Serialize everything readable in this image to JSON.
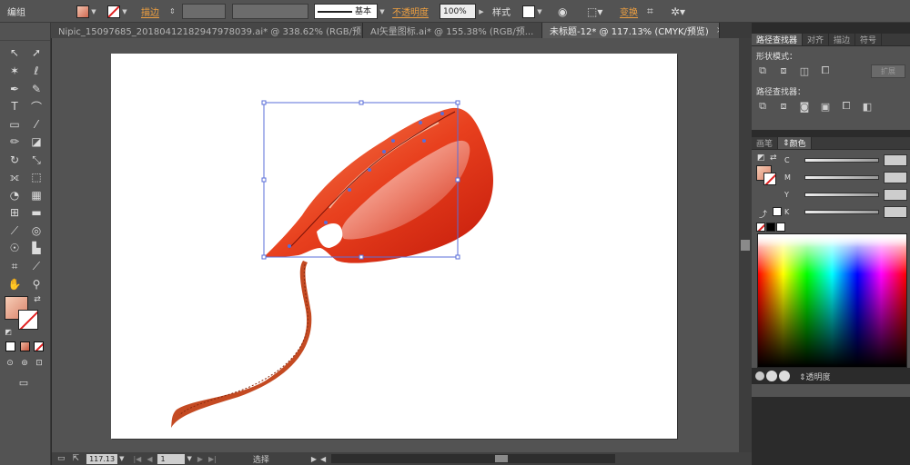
{
  "control_bar": {
    "selection_label": "编组",
    "stroke_label": "描边",
    "stroke_style_label": "基本",
    "opacity_label": "不透明度",
    "opacity_value": "100%",
    "style_label": "样式",
    "transform_label": "变换"
  },
  "tabs": [
    {
      "label": "Nipic_15097685_20180412182947978039.ai* @ 338.62% (RGB/预...",
      "active": false
    },
    {
      "label": "AI矢量图标.ai* @ 155.38% (RGB/预...",
      "active": false
    },
    {
      "label": "未标题-12* @ 117.13% (CMYK/预览)",
      "active": true
    }
  ],
  "tab_close_glyph": "×",
  "toolbar": {
    "tools": [
      "selection-tool",
      "direct-selection-tool",
      "magic-wand-tool",
      "lasso-tool",
      "pen-tool",
      "curvature-tool",
      "type-tool",
      "line-segment-tool",
      "rectangle-tool",
      "paintbrush-tool",
      "pencil-tool",
      "eraser-tool",
      "rotate-tool",
      "scale-tool",
      "width-tool",
      "free-transform-tool",
      "shape-builder-tool",
      "perspective-grid-tool",
      "mesh-tool",
      "gradient-tool",
      "eyedropper-tool",
      "blend-tool",
      "symbol-sprayer-tool",
      "column-graph-tool",
      "artboard-tool",
      "slice-tool",
      "hand-tool",
      "zoom-tool"
    ],
    "fill_color": "#e0a08a",
    "stroke_color": "none"
  },
  "artwork": {
    "body_colors": [
      "#c41a0a",
      "#e8401e",
      "#f58a5a"
    ],
    "tail_color": "#c44a22",
    "selection_color": "#5a6ed8"
  },
  "status_bar": {
    "zoom": "117.13",
    "artboard_number": "1",
    "tool_status": "选择"
  },
  "pathfinder_panel": {
    "tabs": [
      "路径查找器",
      "对齐",
      "描边",
      "符号"
    ],
    "shape_modes_label": "形状模式：",
    "expand_label": "扩展",
    "pathfinders_label": "路径查找器："
  },
  "color_panel": {
    "tabs": [
      "画笔",
      "颜色"
    ],
    "channels": [
      "C",
      "M",
      "Y",
      "K"
    ]
  },
  "transparency_panel": {
    "label": "透明度"
  }
}
